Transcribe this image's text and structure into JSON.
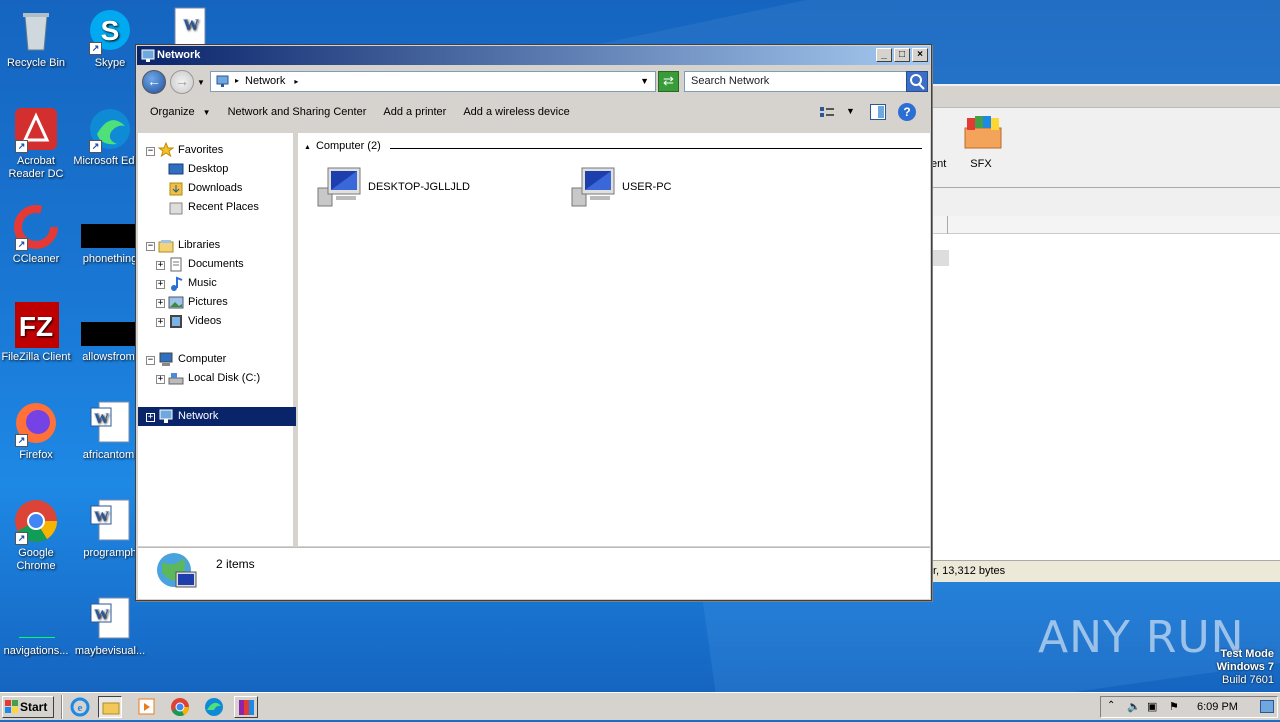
{
  "desktop": {
    "icons": [
      {
        "label": "Recycle Bin",
        "icon": "recycle-bin-icon"
      },
      {
        "label": "Skype",
        "icon": "skype-icon"
      },
      {
        "label": "Acrobat Reader DC",
        "icon": "acrobat-icon"
      },
      {
        "label": "Microsoft Edge",
        "icon": "edge-icon"
      },
      {
        "label": "CCleaner",
        "icon": "ccleaner-icon"
      },
      {
        "label": "phonething",
        "icon": "black-file-icon"
      },
      {
        "label": "FileZilla Client",
        "icon": "filezilla-icon"
      },
      {
        "label": "allowsfrom.",
        "icon": "black-file-icon"
      },
      {
        "label": "Firefox",
        "icon": "firefox-icon"
      },
      {
        "label": "africantom.",
        "icon": "word-doc-icon"
      },
      {
        "label": "Google Chrome",
        "icon": "chrome-icon"
      },
      {
        "label": "programph",
        "icon": "word-doc-icon"
      },
      {
        "label": "navigations...",
        "icon": "file-icon"
      },
      {
        "label": "maybevisual...",
        "icon": "word-doc-icon"
      }
    ],
    "watermark": {
      "line1": "Test Mode",
      "line2": "Windows 7",
      "line3": "Build 7601"
    },
    "anyrun": "ANY RUN"
  },
  "background_window": {
    "tool_labels": [
      "ent",
      "SFX"
    ],
    "status": "r, 13,312 bytes"
  },
  "window": {
    "title": "Network",
    "address": "Network",
    "search_placeholder": "Search Network",
    "toolbar": {
      "organize": "Organize",
      "network_sharing": "Network and Sharing Center",
      "add_printer": "Add a printer",
      "add_wireless": "Add a wireless device"
    },
    "nav": {
      "favorites": "Favorites",
      "desktop": "Desktop",
      "downloads": "Downloads",
      "recent": "Recent Places",
      "libraries": "Libraries",
      "documents": "Documents",
      "music": "Music",
      "pictures": "Pictures",
      "videos": "Videos",
      "computer": "Computer",
      "local_disk": "Local Disk (C:)",
      "network": "Network"
    },
    "group_header": "Computer (2)",
    "computers": [
      "DESKTOP-JGLLJLD",
      "USER-PC"
    ],
    "details": "2 items"
  },
  "taskbar": {
    "start": "Start",
    "time": "6:09 PM"
  }
}
